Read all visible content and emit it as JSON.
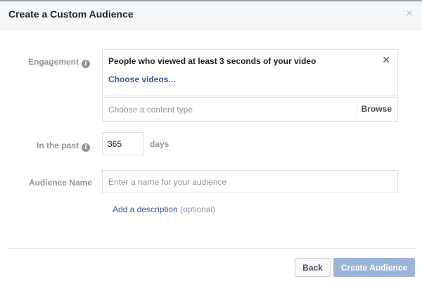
{
  "dialog": {
    "title": "Create a Custom Audience",
    "close_glyph": "×"
  },
  "engagement": {
    "label": "Engagement",
    "selected_title": "People who viewed at least 3 seconds of your video",
    "remove_glyph": "✕",
    "choose_link": "Choose videos...",
    "content_type_placeholder": "Choose a content type",
    "browse_label": "Browse"
  },
  "in_the_past": {
    "label": "In the past",
    "value": "365",
    "unit": "days"
  },
  "audience_name": {
    "label": "Audience Name",
    "placeholder": "Enter a name for your audience"
  },
  "description": {
    "link_text": "Add a description",
    "optional_text": "(optional)"
  },
  "footer": {
    "back_label": "Back",
    "create_label": "Create Audience"
  },
  "colors": {
    "link": "#365899",
    "label_gray": "#90949c",
    "primary_disabled": "#9cb4d8"
  },
  "icons": {
    "info": "i"
  }
}
